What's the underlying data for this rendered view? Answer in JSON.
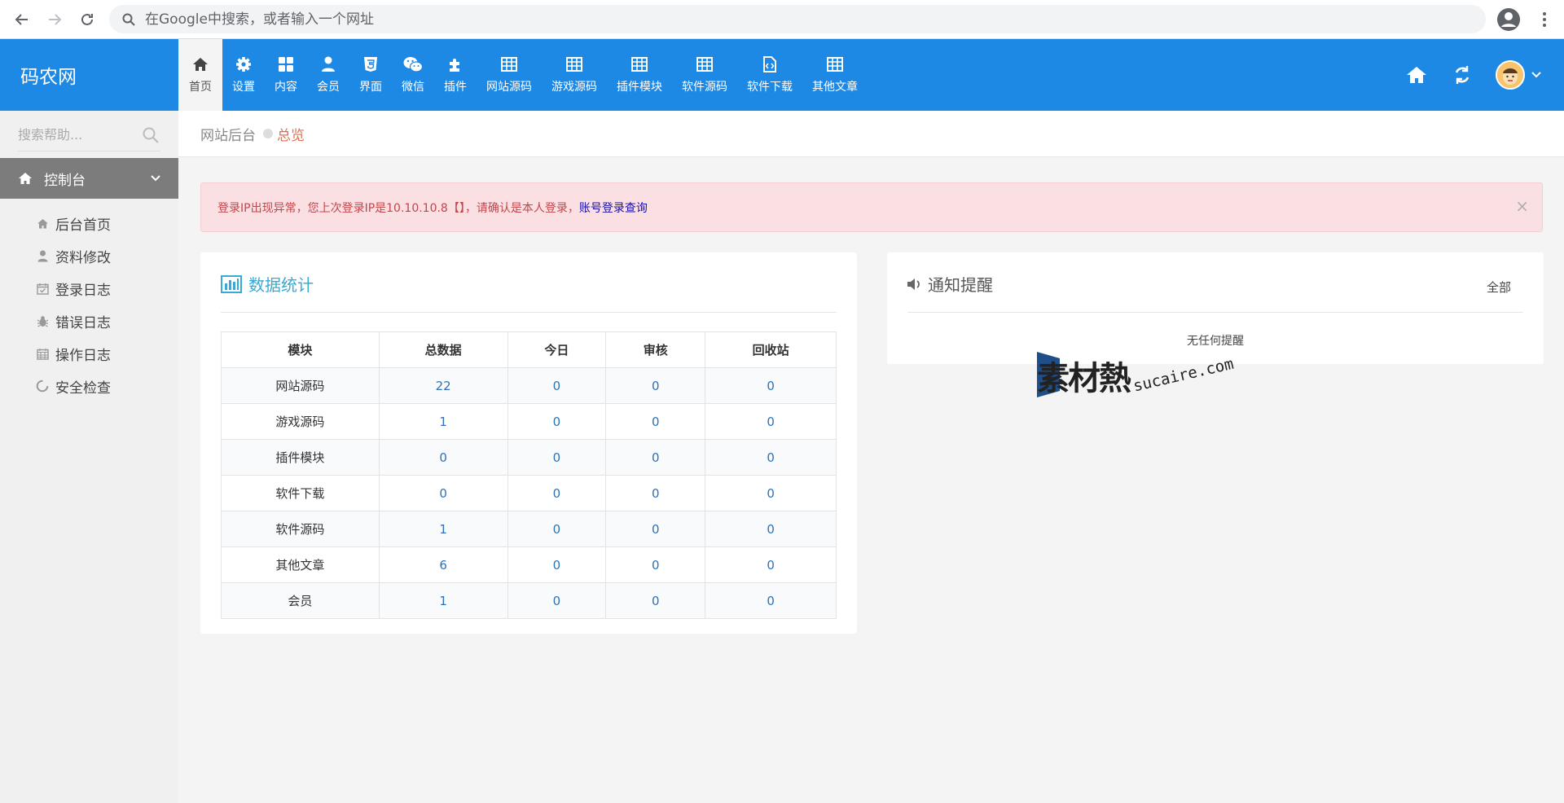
{
  "browser": {
    "omnibox_placeholder": "在Google中搜索，或者输入一个网址"
  },
  "brand": {
    "name": "码农网"
  },
  "topnav": [
    {
      "label": "首页",
      "icon": "home-icon",
      "active": true
    },
    {
      "label": "设置",
      "icon": "gear-icon"
    },
    {
      "label": "内容",
      "icon": "grid-icon"
    },
    {
      "label": "会员",
      "icon": "user-icon"
    },
    {
      "label": "界面",
      "icon": "html5-icon"
    },
    {
      "label": "微信",
      "icon": "wechat-icon"
    },
    {
      "label": "插件",
      "icon": "puzzle-icon"
    },
    {
      "label": "网站源码",
      "icon": "table-icon"
    },
    {
      "label": "游戏源码",
      "icon": "table-icon"
    },
    {
      "label": "插件模块",
      "icon": "table-icon"
    },
    {
      "label": "软件源码",
      "icon": "table-icon"
    },
    {
      "label": "软件下载",
      "icon": "file-code-icon"
    },
    {
      "label": "其他文章",
      "icon": "table-icon"
    }
  ],
  "sidebar": {
    "search_placeholder": "搜索帮助...",
    "section_label": "控制台",
    "items": [
      {
        "label": "后台首页",
        "icon": "home-icon"
      },
      {
        "label": "资料修改",
        "icon": "user-icon"
      },
      {
        "label": "登录日志",
        "icon": "calendar-check-icon"
      },
      {
        "label": "错误日志",
        "icon": "bug-icon"
      },
      {
        "label": "操作日志",
        "icon": "calendar-icon"
      },
      {
        "label": "安全检查",
        "icon": "spinner-icon"
      }
    ]
  },
  "breadcrumb": {
    "root": "网站后台",
    "current": "总览"
  },
  "alert": {
    "message": "登录IP出现异常，您上次登录IP是10.10.10.8【】，请确认是本人登录，",
    "link": "账号登录查询",
    "close": "×"
  },
  "stats": {
    "title": "数据统计",
    "headers": [
      "模块",
      "总数据",
      "今日",
      "审核",
      "回收站"
    ],
    "rows": [
      [
        "网站源码",
        "22",
        "0",
        "0",
        "0"
      ],
      [
        "游戏源码",
        "1",
        "0",
        "0",
        "0"
      ],
      [
        "插件模块",
        "0",
        "0",
        "0",
        "0"
      ],
      [
        "软件下载",
        "0",
        "0",
        "0",
        "0"
      ],
      [
        "软件源码",
        "1",
        "0",
        "0",
        "0"
      ],
      [
        "其他文章",
        "6",
        "0",
        "0",
        "0"
      ],
      [
        "会员",
        "1",
        "0",
        "0",
        "0"
      ]
    ]
  },
  "notice": {
    "title": "通知提醒",
    "all_label": "全部",
    "empty": "无任何提醒"
  },
  "watermark": {
    "cn": "素材熱",
    "en": "sucaire.com"
  },
  "colors": {
    "topbar": "#1e88e5",
    "sidebar_section": "#7c7c7c",
    "alert_bg": "#fbe0e3",
    "stats_title": "#3aa9d4",
    "table_number": "#2e73b8"
  }
}
